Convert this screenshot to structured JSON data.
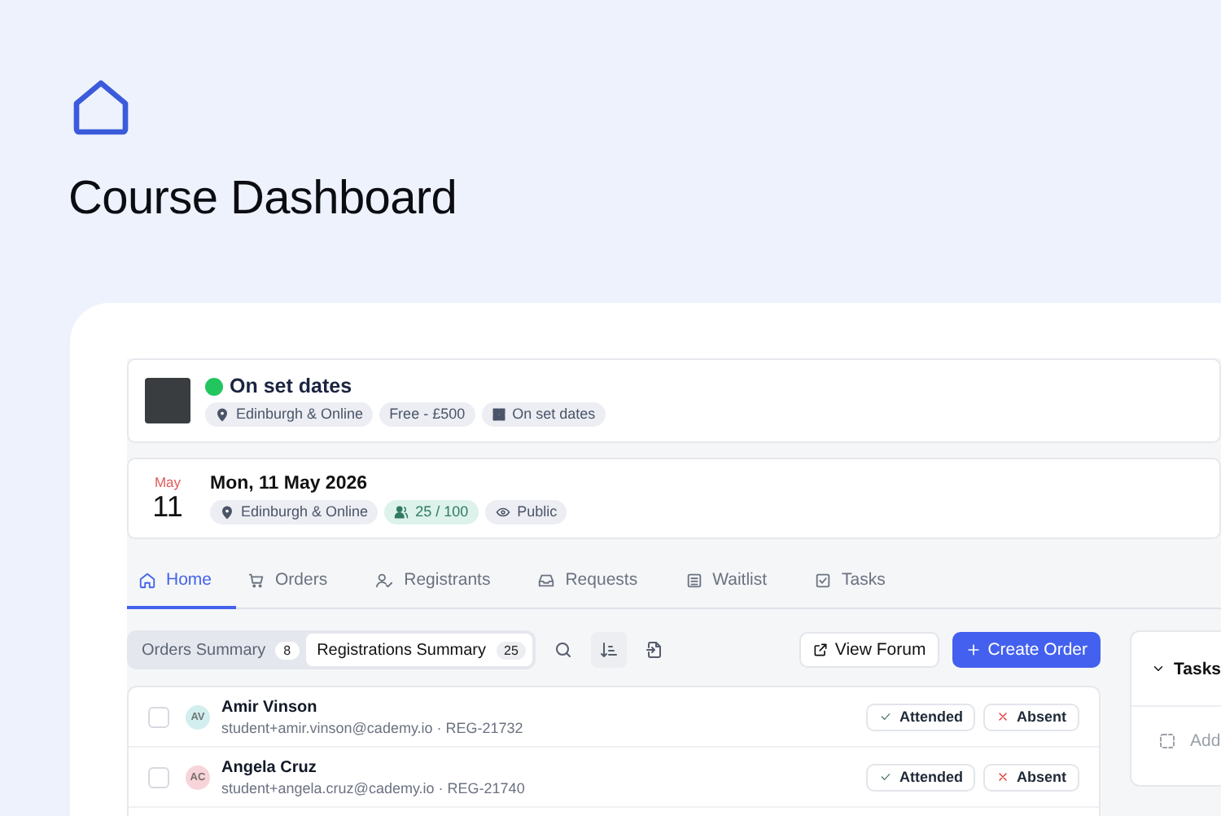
{
  "page": {
    "title": "Course Dashboard"
  },
  "event": {
    "color": "#22c55e",
    "title": "On set dates",
    "tags": [
      {
        "kind": "location",
        "label": "Edinburgh & Online"
      },
      {
        "kind": "plain",
        "label": "Free - £500"
      },
      {
        "kind": "schedule",
        "label": "On set dates"
      }
    ]
  },
  "session": {
    "month": "May",
    "day": "11",
    "date": "Mon, 11 May 2026",
    "tags": [
      {
        "kind": "location",
        "label": "Edinburgh & Online"
      },
      {
        "kind": "capacity",
        "label": "25 / 100"
      },
      {
        "kind": "visibility",
        "label": "Public"
      }
    ]
  },
  "tabs": [
    {
      "label": "Home",
      "selected": true
    },
    {
      "label": "Orders",
      "selected": false
    },
    {
      "label": "Registrants",
      "selected": false
    },
    {
      "label": "Requests",
      "selected": false
    },
    {
      "label": "Waitlist",
      "selected": false
    },
    {
      "label": "Tasks",
      "selected": false
    }
  ],
  "summary_tabs": [
    {
      "label": "Orders Summary",
      "count": "8",
      "selected": false
    },
    {
      "label": "Registrations Summary",
      "count": "25",
      "selected": true
    }
  ],
  "buttons": [
    {
      "kind": "secondary",
      "label": "View Forum"
    },
    {
      "kind": "primary",
      "label": "Create Order"
    }
  ],
  "registrants": [
    {
      "initials": "AV",
      "color": "#d3eeee",
      "name": "Amir Vinson",
      "detail": "student+amir.vinson@cademy.io · REG-21732",
      "checked": false,
      "actions": [
        "Attended",
        "Absent"
      ]
    },
    {
      "initials": "AC",
      "color": "#f7d4d8",
      "name": "Angela Cruz",
      "detail": "student+angela.cruz@cademy.io · REG-21740",
      "checked": false,
      "actions": [
        "Attended",
        "Absent"
      ]
    }
  ],
  "tasks": {
    "title": "Tasks",
    "add_label": "Add"
  }
}
